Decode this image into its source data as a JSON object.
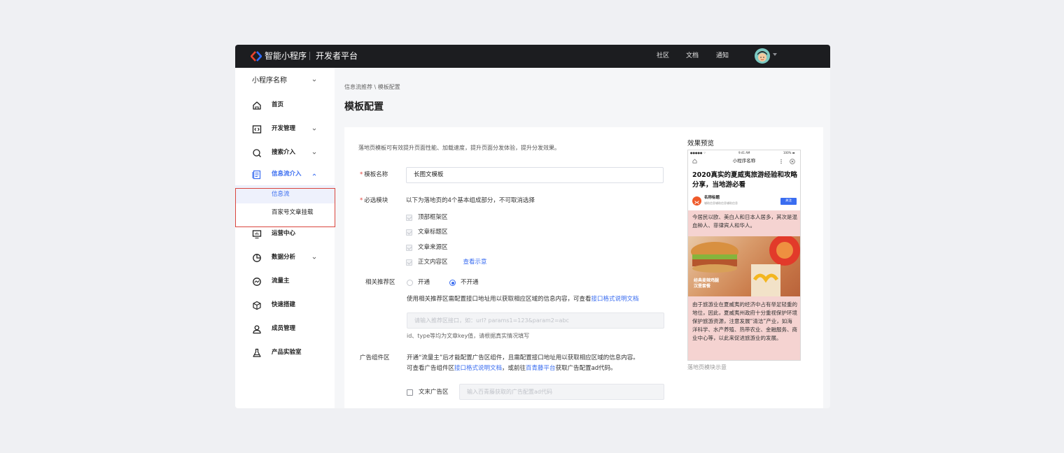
{
  "header": {
    "brand": "智能小程序",
    "platform": "开发者平台",
    "nav": [
      "社区",
      "文档",
      "通知"
    ]
  },
  "sidebar": {
    "app_name": "小程序名称",
    "items": [
      {
        "label": "首页",
        "icon": "home-icon"
      },
      {
        "label": "开发管理",
        "icon": "code-icon"
      },
      {
        "label": "搜索介入",
        "icon": "search-icon"
      },
      {
        "label": "信息流介入",
        "icon": "feed-icon"
      },
      {
        "label": "运营中心",
        "icon": "monitor-icon"
      },
      {
        "label": "数据分析",
        "icon": "pie-chart-icon"
      },
      {
        "label": "流量主",
        "icon": "traffic-icon"
      },
      {
        "label": "快速搭建",
        "icon": "cube-icon"
      },
      {
        "label": "成员管理",
        "icon": "user-icon"
      },
      {
        "label": "产品实验室",
        "icon": "flask-icon"
      }
    ],
    "subitems": [
      "信息流",
      "百家号文章挂载"
    ]
  },
  "breadcrumb": "信息流推荐 \\ 模板配置",
  "page_title": "模板配置",
  "form": {
    "intro": "落地页模板可有效提升页面性能、加载速度，提升页面分发体验，提升分发效果。",
    "template_name_label": "模板名称",
    "template_name_value": "长图文模板",
    "required_modules_label": "必选模块",
    "required_modules_help": "以下为落地页的4个基本组成部分，不可取消选择",
    "modules": [
      "顶部框架区",
      "文章标题区",
      "文章来源区",
      "正文内容区"
    ],
    "view_example": "查看示意",
    "related_label": "相关推荐区",
    "related_options": [
      "开通",
      "不开通"
    ],
    "related_help_prefix": "使用相关推荐区需配置接口地址用以获取相应区域的信息内容，可查看",
    "related_help_link": "接口格式说明文档",
    "related_input_placeholder": "请输入推荐区接口，如：url? params1=123&param2=abc",
    "related_input_help": "id、type等均为文章key值，请根据真实情况填写",
    "ad_label": "广告组件区",
    "ad_help_line1": "开通“流量主”后才能配置广告区组件，且需配置接口地址用以获取相应区域的信息内容。",
    "ad_help_line2_prefix": "可查看广告组件区",
    "ad_help_link1": "接口格式说明文档",
    "ad_help_line2_mid": "，或前往",
    "ad_help_link2": "百青藤平台",
    "ad_help_line2_suffix": "获取广告配置ad代码。",
    "ad_end_label": "文末广告区",
    "ad_end_placeholder": "输入百青藤获取的广告配置ad代码"
  },
  "preview": {
    "title": "效果预览",
    "status_carrier": "●●●●● ⌔",
    "status_time": "9:41 AM",
    "status_battery": "100% ▬",
    "nav_title": "小程序名称",
    "article_title": "2020真实的夏威夷旅游经验和攻略分享，当地游必看",
    "author_name": "名称标题",
    "author_sub": "辅助信息辅助信息辅助信息",
    "follow": "关注",
    "para1": "今居民以欧、美白人和日本人居多，其次是混血种人、菲律宾人和华人。",
    "image_caption": "经典麦辣鸡腿\n汉堡套餐",
    "para2": "由于旅游业在夏威夷的经济中占有举足轻重的地位，因此，夏威夷州政府十分重视保护环境保护旅游资源，注意发展“清洁”产业，如海洋科学、水产养殖、热带农业、金融服务、商业中心等，以此来促进旅游业的发展。",
    "caption": "落地页模块示意"
  },
  "colors": {
    "accent": "#3a6df0",
    "required": "#e0403a",
    "highlight": "#d9453d",
    "topbar": "#1c1d20"
  }
}
